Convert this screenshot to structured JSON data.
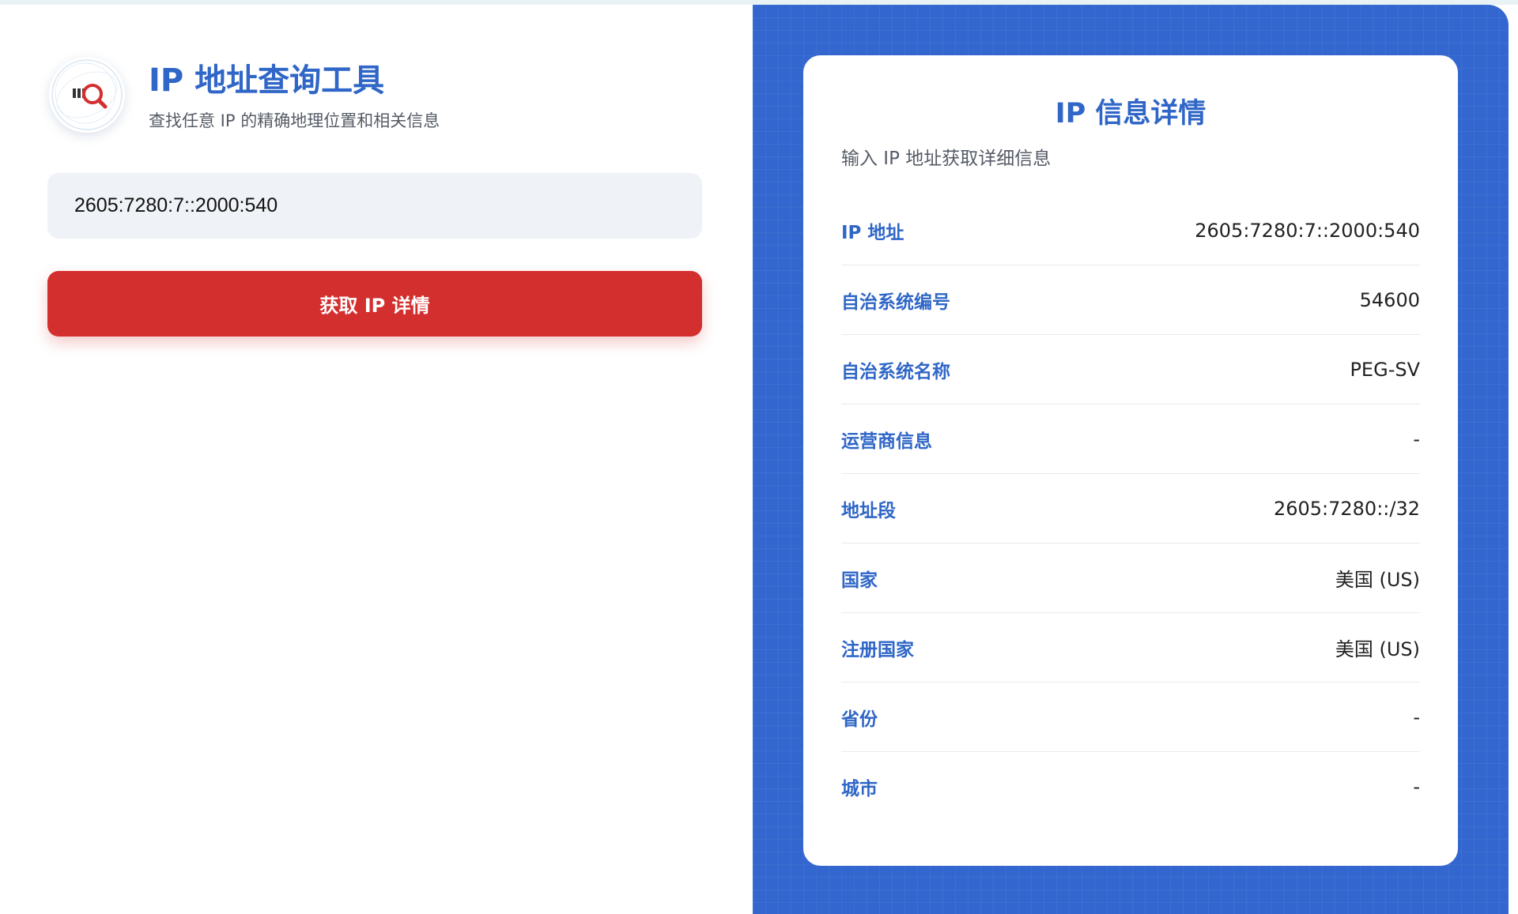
{
  "colors": {
    "accent_blue": "#2f66c7",
    "panel_blue": "#3367cf",
    "button_red": "#d32f2f",
    "input_bg": "#eff2f6"
  },
  "header": {
    "logo_icon": "search-ip-logo-icon",
    "title": "IP 地址查询工具",
    "subtitle": "查找任意 IP 的精确地理位置和相关信息"
  },
  "search": {
    "value": "2605:7280:7::2000:540",
    "button_label": "获取 IP 详情"
  },
  "details": {
    "title": "IP 信息详情",
    "subtitle": "输入 IP 地址获取详细信息",
    "rows": [
      {
        "label": "IP 地址",
        "value": "2605:7280:7::2000:540"
      },
      {
        "label": "自治系统编号",
        "value": "54600"
      },
      {
        "label": "自治系统名称",
        "value": "PEG-SV"
      },
      {
        "label": "运营商信息",
        "value": "-"
      },
      {
        "label": "地址段",
        "value": "2605:7280::/32"
      },
      {
        "label": "国家",
        "value": "美国 (US)"
      },
      {
        "label": "注册国家",
        "value": "美国 (US)"
      },
      {
        "label": "省份",
        "value": "-"
      },
      {
        "label": "城市",
        "value": "-"
      }
    ]
  }
}
